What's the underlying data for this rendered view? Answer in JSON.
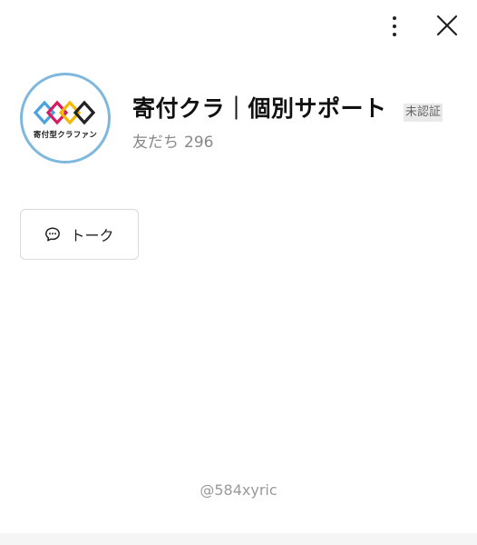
{
  "header": {
    "menu_icon": "more-vertical-icon",
    "close_icon": "close-icon"
  },
  "profile": {
    "avatar_text": "寄付型クラファン",
    "name": "寄付クラ｜個別サポート",
    "badge": "未認証",
    "friends_label": "友だち",
    "friends_count": "296"
  },
  "actions": {
    "talk_label": "トーク",
    "talk_icon": "chat-bubble-icon"
  },
  "footer": {
    "handle": "@584xyric"
  },
  "colors": {
    "avatar_border": "#7fb8de",
    "logo_blue": "#4aa3df",
    "logo_red": "#d81b60",
    "logo_yellow": "#f5b800",
    "logo_dark": "#222222"
  }
}
